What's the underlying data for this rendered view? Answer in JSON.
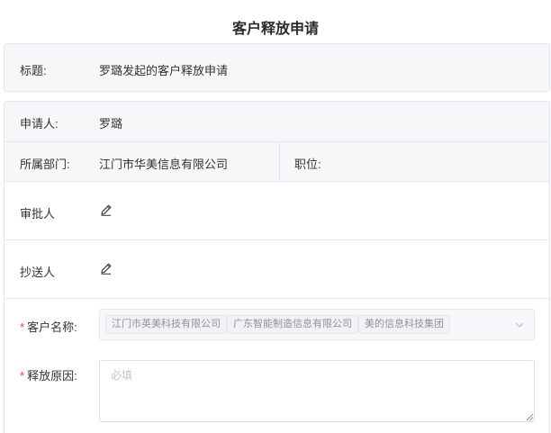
{
  "page": {
    "title": "客户释放申请"
  },
  "title_row": {
    "label": "标题:",
    "value": "罗璐发起的客户释放申请"
  },
  "applicant": {
    "label": "申请人:",
    "value": "罗璐"
  },
  "department": {
    "label": "所属部门:",
    "value": "江门市华美信息有限公司"
  },
  "position": {
    "label": "职位:"
  },
  "approver": {
    "label": "审批人",
    "icon": "pencil-icon"
  },
  "cc": {
    "label": "抄送人",
    "icon": "pencil-icon"
  },
  "customer": {
    "required_mark": "*",
    "label": "客户名称:",
    "tags": [
      "江门市英美科技有限公司",
      "广东智能制造信息有限公司",
      "美的信息科技集团"
    ],
    "icon": "chevron-down-icon"
  },
  "reason": {
    "required_mark": "*",
    "label": "释放原因:",
    "placeholder": "必填"
  }
}
